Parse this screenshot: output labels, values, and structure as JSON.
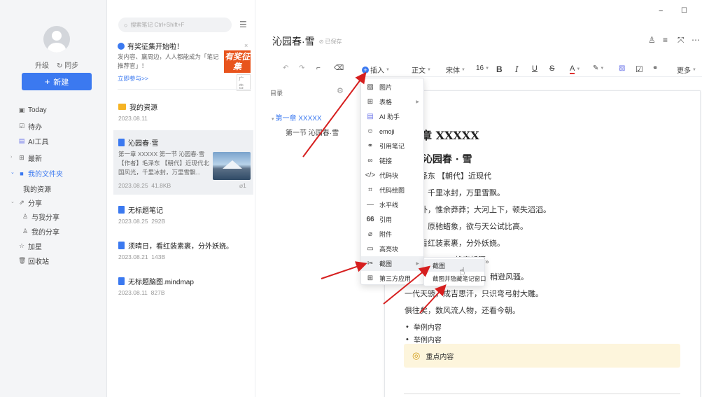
{
  "window": {
    "minimize": "−",
    "maximize": "☐"
  },
  "sidebar": {
    "upgrade": "升级",
    "sync": "同步",
    "new_button": "新建",
    "nav": [
      {
        "label": "Today",
        "icon": "calendar-icon"
      },
      {
        "label": "待办",
        "icon": "checkbox-icon"
      },
      {
        "label": "AI工具",
        "icon": "ai-icon"
      },
      {
        "label": "最新",
        "icon": "grid-icon"
      },
      {
        "label": "我的文件夹",
        "icon": "folder-icon"
      },
      {
        "label": "我的资源"
      },
      {
        "label": "分享",
        "icon": "share-icon"
      },
      {
        "label": "与我分享",
        "icon": "user-icon"
      },
      {
        "label": "我的分享",
        "icon": "user-icon"
      },
      {
        "label": "加星",
        "icon": "star-icon"
      },
      {
        "label": "回收站",
        "icon": "trash-icon"
      }
    ]
  },
  "notelist": {
    "search_placeholder": "搜索笔记 Ctrl+Shift+F",
    "ad": {
      "title": "有奖征集开始啦！",
      "desc": "发内容、赢周边，人人都能成为「笔记推荐官」！",
      "link": "立即参与>>",
      "badge": "有奖征集",
      "tag": "广告",
      "close": "×"
    },
    "items": [
      {
        "title": "我的资源",
        "meta": "2023.08.11"
      },
      {
        "title": "沁园春·雪",
        "excerpt": "第一章 XXXXX 第一节 沁园春·雪【作者】毛泽东 【朝代】近现代北国风光，千里冰封，万里雪飘...",
        "date": "2023.08.25",
        "size": "41.8KB",
        "count": "1"
      },
      {
        "title": "无标题笔记",
        "date": "2023.08.25",
        "size": "292B"
      },
      {
        "title": "须晴日，看红装素裹，分外妖娆。",
        "date": "2023.08.21",
        "size": "143B"
      },
      {
        "title": "无标题脑图.mindmap",
        "date": "2023.08.11",
        "size": "827B"
      }
    ]
  },
  "editor": {
    "title": "沁园春·雪",
    "saved": "已保存",
    "toolbar": {
      "insert": "插入",
      "style": "正文",
      "font": "宋体",
      "size": "16",
      "more": "更多"
    },
    "toc": {
      "label": "目录",
      "h1": "第一章 XXXXX",
      "h2": "第一节 沁园春·雪"
    },
    "doc": {
      "h1": "一章 XXXXX",
      "h2": "节 沁园春 · 雪",
      "lines": [
        "】毛泽东 【朝代】近现代",
        "风光，千里冰封，万里雪飘。",
        "城内外，惟余莽莽；大河上下，顿失滔滔。",
        "银蛇，原驰蜡象，欲与天公试比高。",
        "日，看红装素裹，分外妖娆。",
        "雄竞折腰。",
        "唐宗宋祖，稍逊风骚。",
        "一代天骄，成吉思汗，只识弯弓射大雕。",
        "俱往矣，数风流人物，还看今朝。"
      ],
      "bullets": [
        "举例内容",
        "举例内容"
      ],
      "callout": "重点内容"
    }
  },
  "insert_menu": [
    {
      "label": "图片",
      "icon": "image-icon"
    },
    {
      "label": "表格",
      "icon": "table-icon",
      "sub": true
    },
    {
      "label": "AI 助手",
      "icon": "ai-icon"
    },
    {
      "label": "emoji",
      "icon": "emoji-icon"
    },
    {
      "label": "引用笔记",
      "icon": "link-icon"
    },
    {
      "label": "链接",
      "icon": "chain-icon"
    },
    {
      "label": "代码块",
      "icon": "code-icon"
    },
    {
      "label": "代码绘图",
      "icon": "code-draw-icon"
    },
    {
      "label": "水平线",
      "icon": "hr-icon"
    },
    {
      "label": "引用",
      "icon": "quote-icon"
    },
    {
      "label": "附件",
      "icon": "paperclip-icon"
    },
    {
      "label": "高亮块",
      "icon": "highlight-icon"
    },
    {
      "label": "截图",
      "icon": "scissors-icon",
      "sub": true
    },
    {
      "label": "第三方应用",
      "icon": "apps-icon"
    }
  ],
  "screenshot_menu": [
    {
      "label": "截图"
    },
    {
      "label": "截图并隐藏笔记窗口"
    }
  ]
}
